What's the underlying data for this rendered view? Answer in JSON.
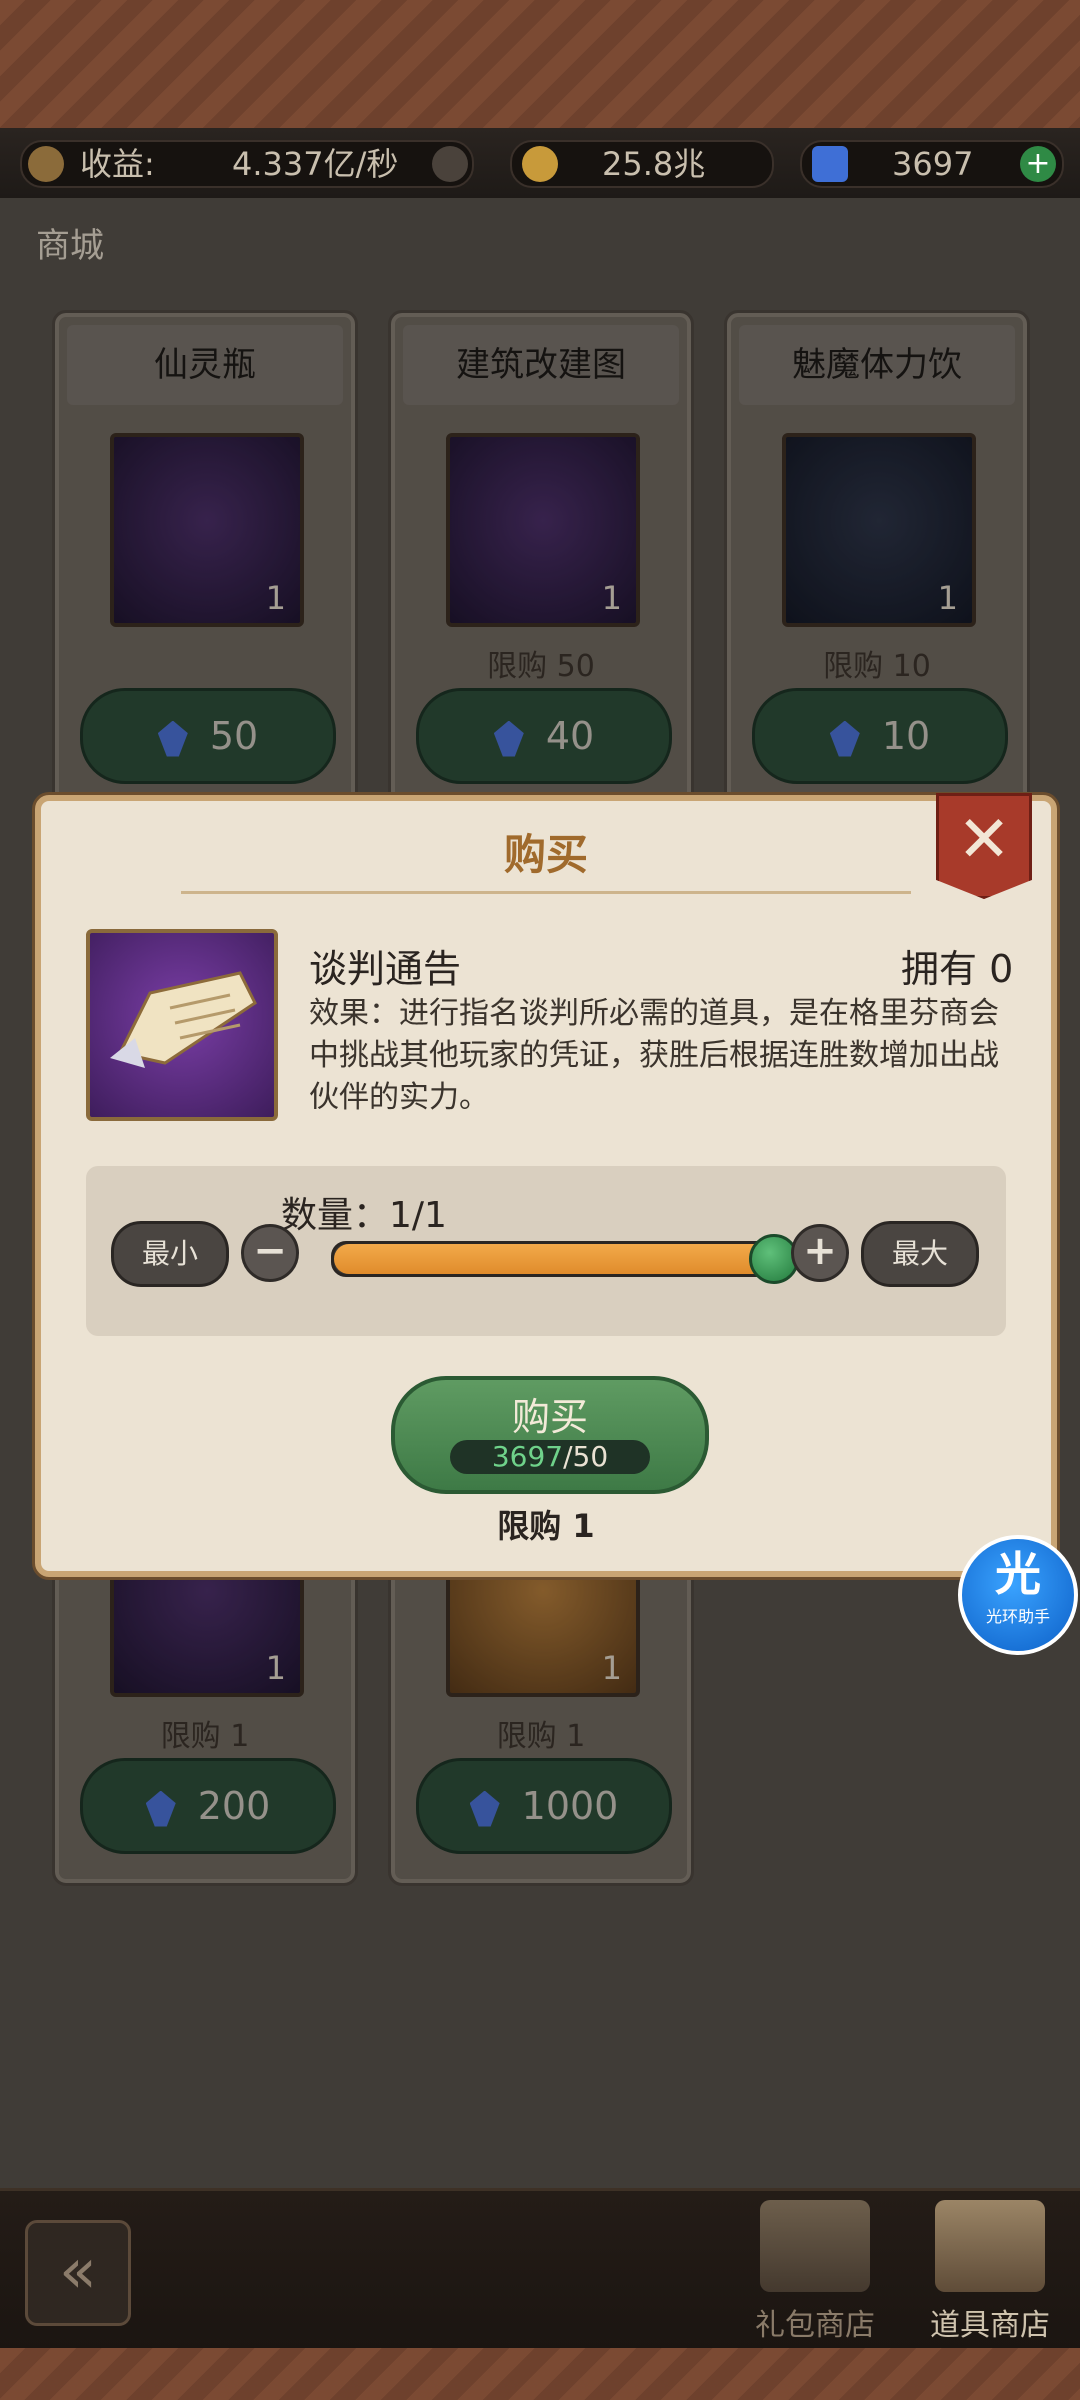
{
  "header": {
    "income_label": "收益:",
    "income_value": "4.337亿/秒",
    "gold_value": "25.8兆",
    "gem_value": "3697",
    "plus_icon": "plus-icon"
  },
  "shop": {
    "title": "商城",
    "items": [
      {
        "name": "仙灵瓶",
        "qty": "1",
        "limit": "",
        "price": "50"
      },
      {
        "name": "建筑改建图",
        "qty": "1",
        "limit": "限购 50",
        "price": "40"
      },
      {
        "name": "魅魔体力饮",
        "qty": "1",
        "limit": "限购 10",
        "price": "10"
      },
      {
        "name": "",
        "qty": "1",
        "limit": "限购 1",
        "price": "200"
      },
      {
        "name": "",
        "qty": "1",
        "limit": "限购 1",
        "price": "1000"
      }
    ]
  },
  "modal": {
    "title": "购买",
    "close_symbol": "✕",
    "item_name": "谈判通告",
    "owned": "拥有 0",
    "description": "效果：进行指名谈判所必需的道具，是在格里芬商会中挑战其他玩家的凭证，获胜后根据连胜数增加出战伙伴的实力。",
    "quantity_label": "数量：1/1",
    "quantity_fraction": 1.0,
    "min_label": "最小",
    "max_label": "最大",
    "minus_symbol": "−",
    "plus_symbol": "+",
    "buy_label": "购买",
    "cost_have": "3697",
    "cost_need": "/50",
    "limit": "限购 1"
  },
  "assistant": {
    "big": "光",
    "small": "光环助手"
  },
  "bottom_nav": {
    "back_symbol": "«",
    "items": [
      {
        "label": "礼包商店"
      },
      {
        "label": "道具商店"
      }
    ]
  },
  "colors": {
    "accent_gold": "#a06a2c",
    "close_red": "#a83a2a",
    "buy_green": "#3e7a46",
    "slider_orange": "#e08c2c"
  }
}
